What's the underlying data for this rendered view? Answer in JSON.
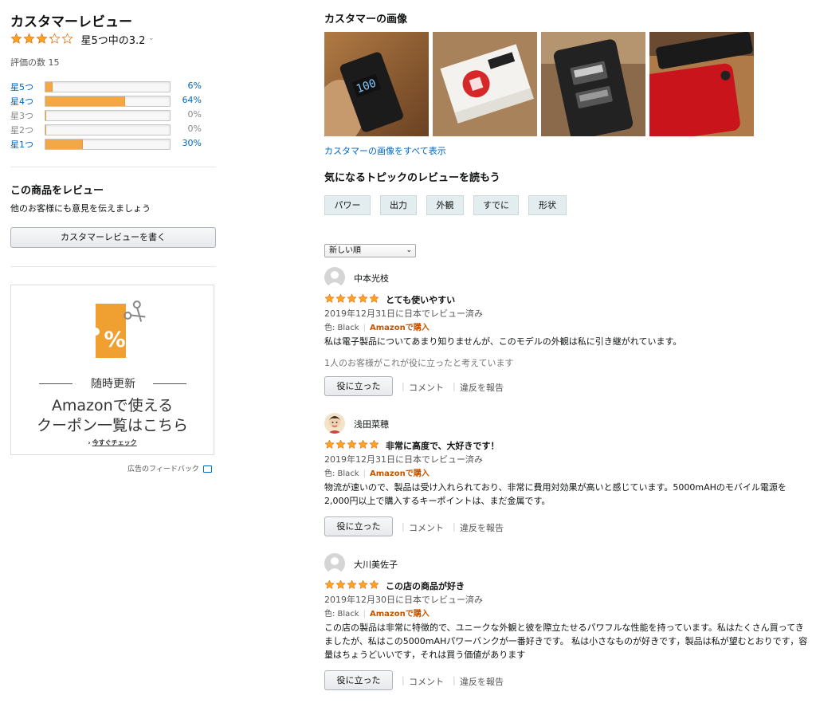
{
  "left": {
    "title": "カスタマーレビュー",
    "rating_text": "星5つ中の3.2",
    "rating_value": 3.2,
    "rating_count": "評価の数 15",
    "histogram": [
      {
        "label": "星5つ",
        "pct_text": "6%",
        "fraction": 0.06,
        "link": true
      },
      {
        "label": "星4つ",
        "pct_text": "64%",
        "fraction": 0.64,
        "link": true
      },
      {
        "label": "星3つ",
        "pct_text": "0%",
        "fraction": 0,
        "link": false
      },
      {
        "label": "星2つ",
        "pct_text": "0%",
        "fraction": 0,
        "link": false
      },
      {
        "label": "星1つ",
        "pct_text": "30%",
        "fraction": 0.3,
        "link": true
      }
    ],
    "review_prompt_title": "この商品をレビュー",
    "review_prompt_sub": "他のお客様にも意見を伝えましょう",
    "write_review_button": "カスタマーレビューを書く",
    "ad": {
      "subtitle": "随時更新",
      "line1": "Amazonで使える",
      "line2": "クーポン一覧はこちら",
      "cta": "今すぐチェック",
      "percent_symbol": "%"
    },
    "ad_feedback": "広告のフィードバック"
  },
  "right": {
    "images_title": "カスタマーの画像",
    "see_all_images": "カスタマーの画像をすべて表示",
    "topics_title": "気になるトピックのレビューを読もう",
    "topics": [
      "パワー",
      "出力",
      "外観",
      "すでに",
      "形状"
    ],
    "sort_select": "新しい順",
    "reviews": [
      {
        "user": "中本光枝",
        "title": "とても使いやすい",
        "stars": 5,
        "date": "2019年12月31日に日本でレビュー済み",
        "color": "色: Black",
        "verified": "Amazonで購入",
        "body": "私は電子製品についてあまり知りませんが、このモデルの外観は私に引き継がれています。",
        "helpful": "1人のお客様がこれが役に立ったと考えています",
        "helpful_button": "役に立った",
        "comment": "コメント",
        "report": "違反を報告"
      },
      {
        "user": "浅田菜穂",
        "title": "非常に高度で、大好きです！",
        "stars": 5,
        "date": "2019年12月31日に日本でレビュー済み",
        "color": "色: Black",
        "verified": "Amazonで購入",
        "body": "物流が速いので、製品は受け入れられており、非常に費用対効果が高いと感じています。5000mAHのモバイル電源を2,000円以上で購入するキーポイントは、まだ金属です。",
        "helpful": "",
        "helpful_button": "役に立った",
        "comment": "コメント",
        "report": "違反を報告"
      },
      {
        "user": "大川美佐子",
        "title": "この店の商品が好き",
        "stars": 5,
        "date": "2019年12月30日に日本でレビュー済み",
        "color": "色: Black",
        "verified": "Amazonで購入",
        "body": "この店の製品は非常に特徴的で、ユニークな外観と彼を際立たせるパワフルな性能を持っています。私はたくさん買ってきましたが、私はこの5000mAHパワーバンクが一番好きです。 私は小さなものが好きです，製品は私が望むとおりです，容量はちょうどいいです，それは買う価値があります",
        "helpful": "",
        "helpful_button": "役に立った",
        "comment": "コメント",
        "report": "違反を報告"
      }
    ]
  },
  "colors": {
    "star": "#ffa41c",
    "bar_fill": "#f3a847",
    "link": "#0066c0",
    "verified": "#c45500",
    "ad_orange": "#f0a030"
  }
}
